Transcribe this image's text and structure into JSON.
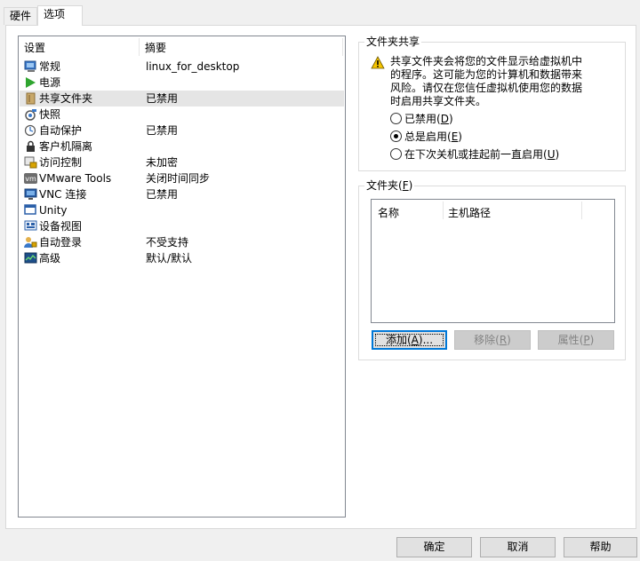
{
  "tabs": [
    {
      "label": "硬件",
      "active": false
    },
    {
      "label": "选项",
      "active": true
    }
  ],
  "settings": {
    "col_setting": "设置",
    "col_summary": "摘要",
    "items": [
      {
        "name": "常规",
        "summary": "linux_for_desktop",
        "icon": "general-icon",
        "selected": false
      },
      {
        "name": "电源",
        "summary": "",
        "icon": "power-play-icon",
        "selected": false
      },
      {
        "name": "共享文件夹",
        "summary": "已禁用",
        "icon": "shared-folder-icon",
        "selected": true
      },
      {
        "name": "快照",
        "summary": "",
        "icon": "snapshot-icon",
        "selected": false
      },
      {
        "name": "自动保护",
        "summary": "已禁用",
        "icon": "autoprotect-icon",
        "selected": false
      },
      {
        "name": "客户机隔离",
        "summary": "",
        "icon": "isolation-lock-icon",
        "selected": false
      },
      {
        "name": "访问控制",
        "summary": "未加密",
        "icon": "access-control-icon",
        "selected": false
      },
      {
        "name": "VMware Tools",
        "summary": "关闭时间同步",
        "icon": "vmware-tools-icon",
        "selected": false
      },
      {
        "name": "VNC 连接",
        "summary": "已禁用",
        "icon": "vnc-icon",
        "selected": false
      },
      {
        "name": "Unity",
        "summary": "",
        "icon": "unity-icon",
        "selected": false
      },
      {
        "name": "设备视图",
        "summary": "",
        "icon": "device-view-icon",
        "selected": false
      },
      {
        "name": "自动登录",
        "summary": "不受支持",
        "icon": "autologin-icon",
        "selected": false
      },
      {
        "name": "高级",
        "summary": "默认/默认",
        "icon": "advanced-icon",
        "selected": false
      }
    ]
  },
  "sharing": {
    "title": "文件夹共享",
    "warning": "共享文件夹会将您的文件显示给虚拟机中的程序。这可能为您的计算机和数据带来风险。请仅在您信任虚拟机使用您的数据时启用共享文件夹。",
    "options": [
      {
        "text": "已禁用",
        "key": "D",
        "checked": false
      },
      {
        "text": "总是启用",
        "key": "E",
        "checked": true
      },
      {
        "text": "在下次关机或挂起前一直启用",
        "key": "U",
        "checked": false
      }
    ]
  },
  "folders": {
    "title": "文件夹",
    "title_key": "F",
    "col_name": "名称",
    "col_path": "主机路径",
    "add_label": "添加",
    "add_key": "A",
    "add_suffix": "...",
    "remove_label": "移除",
    "remove_key": "R",
    "props_label": "属性",
    "props_key": "P"
  },
  "footer": {
    "ok": "确定",
    "cancel": "取消",
    "help": "帮助"
  },
  "colors": {
    "selected_row": "#e5e5e5",
    "default_button_border": "#0078d7",
    "warning_yellow": "#f5c400"
  }
}
